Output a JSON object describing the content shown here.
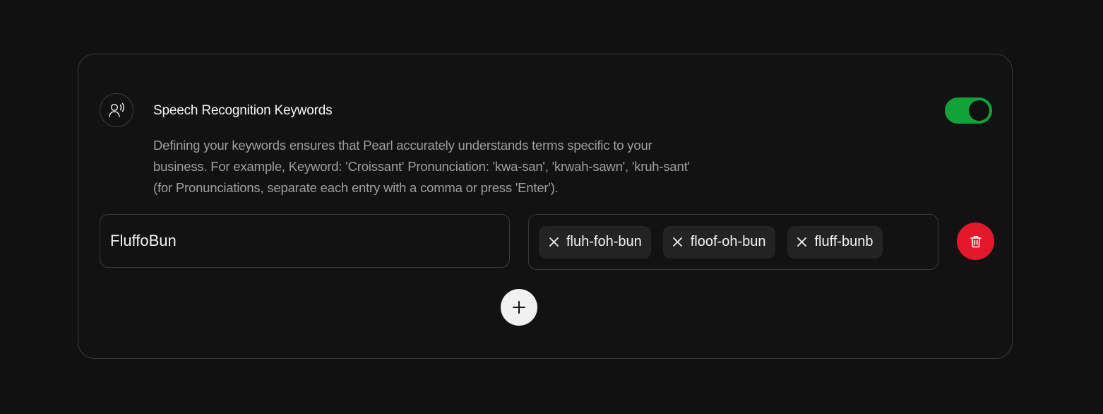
{
  "section": {
    "icon": "voice-user-icon",
    "title": "Speech Recognition Keywords",
    "description": "Defining your keywords ensures that Pearl accurately understands terms specific to your business. For example, Keyword: 'Croissant' Pronunciation: 'kwa-san', 'krwah-sawn', 'kruh-sant' (for Pronunciations, separate each entry with a comma or press 'Enter').",
    "toggle_enabled": true
  },
  "keyword_row": {
    "keyword_value": "FluffoBun",
    "pronunciations": [
      {
        "label": "fluh-foh-bun",
        "remove_icon": "close-icon"
      },
      {
        "label": "floof-oh-bun",
        "remove_icon": "close-icon"
      },
      {
        "label": "fluff-bunb",
        "remove_icon": "close-icon"
      }
    ],
    "delete_icon": "trash-icon"
  },
  "add_button": {
    "icon": "plus-icon"
  },
  "colors": {
    "background": "#111111",
    "card_border": "#3a3a3a",
    "toggle_on": "#11a238",
    "delete": "#e3192b",
    "chip": "#232323",
    "add_button": "#f1f1f1"
  }
}
